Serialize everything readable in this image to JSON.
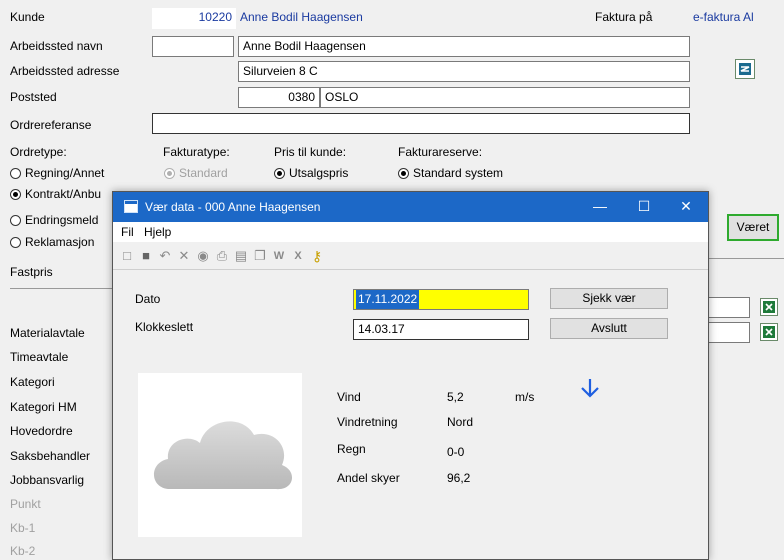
{
  "form": {
    "kunde_label": "Kunde",
    "kunde_nr": "10220",
    "kunde_navn": "Anne Bodil Haagensen",
    "faktura_pa_label": "Faktura på",
    "faktura_pa_value": "e-faktura Al",
    "arbeidssted_navn_label": "Arbeidssted navn",
    "arbeidssted_navn_value": "Anne Bodil Haagensen",
    "arbeidssted_adresse_label": "Arbeidssted adresse",
    "arbeidssted_adresse_value": "Silurveien 8 C",
    "poststed_label": "Poststed",
    "postnr": "0380",
    "poststed_value": "OSLO",
    "ordrereferanse_label": "Ordrereferanse",
    "ordrereferanse_value": "",
    "ordretype_label": "Ordretype:",
    "fakturatype_label": "Fakturatype:",
    "pris_label": "Pris til kunde:",
    "fakturareserve_label": "Fakturareserve:",
    "ordretype_options": [
      "Regning/Annet",
      "Kontrakt/Anbu",
      "Endringsmeld",
      "Reklamasjon"
    ],
    "fakturatype_option": "Standard",
    "pris_option": "Utsalgspris",
    "fakturareserve_option": "Standard system",
    "vaeret_button": "Været",
    "fastpris_label": "Fastpris",
    "left_labels": [
      "Materialavtale",
      "Timeavtale",
      "Kategori",
      "Kategori HM",
      "Hovedordre",
      "Saksbehandler",
      "Jobbansvarlig"
    ],
    "gray_labels": [
      "Punkt",
      "Kb-1",
      "Kb-2"
    ]
  },
  "dialog": {
    "title": "Vær data - 000 Anne Haagensen",
    "minimize": "—",
    "maximize": "☐",
    "close": "✕",
    "menu": [
      "Fil",
      "Hjelp"
    ],
    "dato_label": "Dato",
    "dato_value": "17.11.2022",
    "klokkeslett_label": "Klokkeslett",
    "klokkeslett_value": "14.03.17",
    "sjekk_button": "Sjekk vær",
    "avslutt_button": "Avslutt",
    "vind_label": "Vind",
    "vind_value": "5,2",
    "vind_unit": "m/s",
    "vindretning_label": "Vindretning",
    "vindretning_value": "Nord",
    "regn_label": "Regn",
    "regn_value": "0-0",
    "andel_label": "Andel skyer",
    "andel_value": "96,2"
  },
  "colors": {
    "accent_blue": "#1c68c7",
    "highlight_yellow": "#ffff00",
    "button_border_green": "#2eaa2e"
  }
}
